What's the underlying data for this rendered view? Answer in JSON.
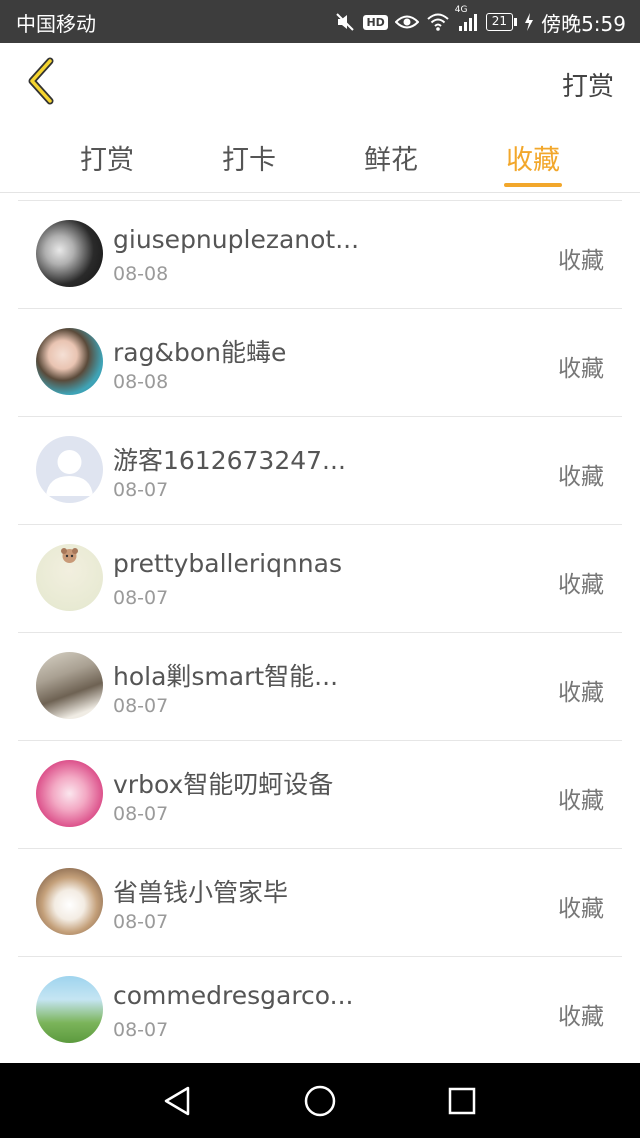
{
  "status_bar": {
    "carrier": "中国移动",
    "network": "4G",
    "hd_badge": "HD",
    "battery": "21",
    "time": "傍晚5:59"
  },
  "header": {
    "back_icon": "chevron-left-icon",
    "title": "打赏"
  },
  "tabs": [
    {
      "label": "打赏",
      "active": false
    },
    {
      "label": "打卡",
      "active": false
    },
    {
      "label": "鲜花",
      "active": false
    },
    {
      "label": "收藏",
      "active": true
    }
  ],
  "colors": {
    "accent": "#f2a72b",
    "status_bar": "#3d3d3d",
    "nav_bar": "#000000"
  },
  "list": [
    {
      "name": "giusepnuplezanot...",
      "date": "08-08",
      "action": "收藏"
    },
    {
      "name": "rag&bon能蝳e",
      "date": "08-08",
      "action": "收藏"
    },
    {
      "name": "游客1612673247...",
      "date": "08-07",
      "action": "收藏"
    },
    {
      "name": "prettyballeriqnnas",
      "date": "08-07",
      "action": "收藏"
    },
    {
      "name": "hola剿smart智能...",
      "date": "08-07",
      "action": "收藏"
    },
    {
      "name": "vrbox智能叨蚵设备",
      "date": "08-07",
      "action": "收藏"
    },
    {
      "name": "省兽钱小管家毕",
      "date": "08-07",
      "action": "收藏"
    },
    {
      "name": "commedresgarco...",
      "date": "08-07",
      "action": "收藏"
    }
  ],
  "nav_bar": {
    "back": "triangle-back-icon",
    "home": "circle-home-icon",
    "recents": "square-recents-icon"
  }
}
